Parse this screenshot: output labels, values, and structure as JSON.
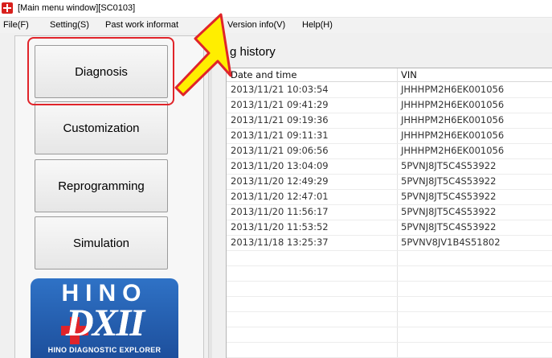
{
  "window": {
    "title": "[Main menu window][SC0103]"
  },
  "menu": [
    {
      "label": "File(F)",
      "name": "menu-file"
    },
    {
      "label": "Setting(S)",
      "name": "menu-setting"
    },
    {
      "label": "Past work informat",
      "name": "menu-past-work-information"
    },
    {
      "label": "Version info(V)",
      "name": "menu-version-info"
    },
    {
      "label": "Help(H)",
      "name": "menu-help"
    }
  ],
  "main_menu": {
    "buttons": [
      {
        "label": "Diagnosis",
        "name": "diagnosis-button"
      },
      {
        "label": "Customization",
        "name": "customization-button"
      },
      {
        "label": "Reprogramming",
        "name": "reprogramming-button"
      },
      {
        "label": "Simulation",
        "name": "simulation-button"
      }
    ],
    "highlight_color": "#e0242a"
  },
  "logo": {
    "brand": "HINO",
    "product": "DXII",
    "tagline": "HINO DIAGNOSTIC EXPLORER"
  },
  "history": {
    "title": "g history",
    "columns": [
      "Date and time",
      "VIN"
    ],
    "rows": [
      [
        "2013/11/21 10:03:54",
        "JHHHPM2H6EK001056"
      ],
      [
        "2013/11/21 09:41:29",
        "JHHHPM2H6EK001056"
      ],
      [
        "2013/11/21 09:19:36",
        "JHHHPM2H6EK001056"
      ],
      [
        "2013/11/21 09:11:31",
        "JHHHPM2H6EK001056"
      ],
      [
        "2013/11/21 09:06:56",
        "JHHHPM2H6EK001056"
      ],
      [
        "2013/11/20 13:04:09",
        "5PVNJ8JT5C4S53922"
      ],
      [
        "2013/11/20 12:49:29",
        "5PVNJ8JT5C4S53922"
      ],
      [
        "2013/11/20 12:47:01",
        "5PVNJ8JT5C4S53922"
      ],
      [
        "2013/11/20 11:56:17",
        "5PVNJ8JT5C4S53922"
      ],
      [
        "2013/11/20 11:53:52",
        "5PVNJ8JT5C4S53922"
      ],
      [
        "2013/11/18 13:25:37",
        "5PVNV8JV1B4S51802"
      ]
    ]
  },
  "annotation": {
    "arrow_color": "#ffee00",
    "arrow_outline": "#e0242a"
  }
}
